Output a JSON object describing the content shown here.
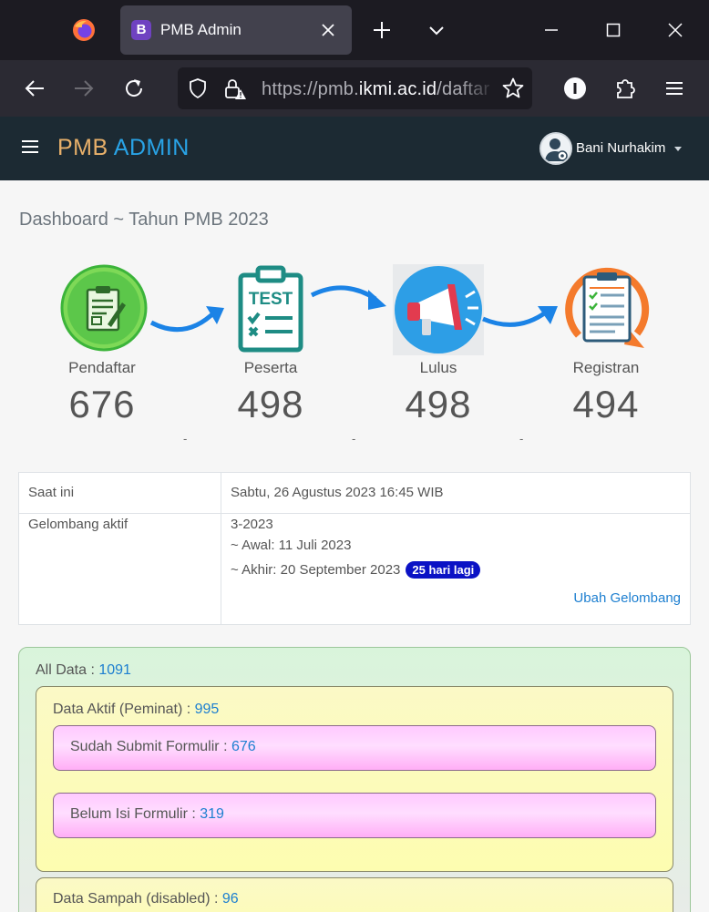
{
  "browser": {
    "tab_title": "PMB Admin",
    "tab_favicon_letter": "B",
    "url_prefix": "https://pmb.",
    "url_domain": "ikmi.ac.id",
    "url_rest": "/daftar"
  },
  "header": {
    "brand_left": "PMB",
    "brand_right": "ADMIN",
    "user_name": "Bani Nurhakim"
  },
  "page": {
    "title": "Dashboard ~ Tahun PMB 2023"
  },
  "stats": [
    {
      "label": "Pendaftar",
      "value": "676"
    },
    {
      "label": "Peserta",
      "value": "498"
    },
    {
      "label": "Lulus",
      "value": "498"
    },
    {
      "label": "Registran",
      "value": "494"
    }
  ],
  "separators": [
    "-",
    "-",
    "-"
  ],
  "info": {
    "now_label": "Saat ini",
    "now_value": "Sabtu, 26 Agustus 2023 16:45 WIB",
    "wave_label": "Gelombang aktif",
    "wave_name": "3-2023",
    "wave_start": "~ Awal: 11 Juli 2023",
    "wave_end": "~ Akhir: 20 September 2023",
    "wave_badge": "25 hari lagi",
    "change_link": "Ubah Gelombang"
  },
  "data_summary": {
    "all_label": "All Data : ",
    "all_value": "1091",
    "active_label": "Data Aktif (Peminat) : ",
    "active_value": "995",
    "submitted_label": "Sudah Submit Formulir : ",
    "submitted_value": "676",
    "not_filled_label": "Belum Isi Formulir : ",
    "not_filled_value": "319",
    "trash_label": "Data Sampah (disabled) : ",
    "trash_value": "96"
  },
  "colors": {
    "header_bg": "#1c2a33",
    "brand_pmb": "#e8b06a",
    "brand_admin": "#29a3e6",
    "link": "#1d7fd0",
    "badge": "#0b12c5"
  }
}
